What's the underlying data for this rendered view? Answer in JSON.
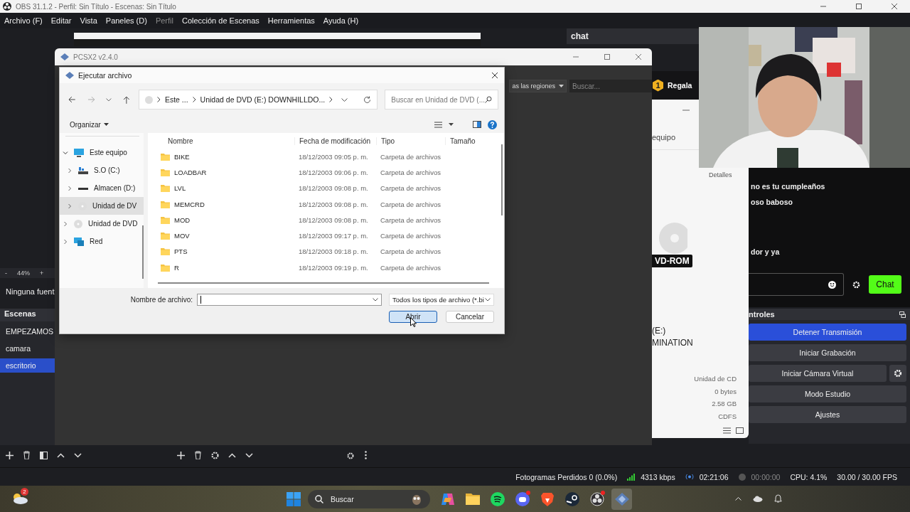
{
  "obs": {
    "title": "OBS 31.1.2 - Perfil: Sin Título - Escenas: Sin Título",
    "menu": [
      {
        "label": "Archivo (F)",
        "disabled": false
      },
      {
        "label": "Editar",
        "disabled": false
      },
      {
        "label": "Vista",
        "disabled": false
      },
      {
        "label": "Paneles (D)",
        "disabled": false
      },
      {
        "label": "Perfil",
        "disabled": true
      },
      {
        "label": "Colección de Escenas",
        "disabled": false
      },
      {
        "label": "Herramientas",
        "disabled": false
      },
      {
        "label": "Ayuda (H)",
        "disabled": false
      }
    ],
    "zoom_out": "-",
    "zoom": "44%",
    "zoom_in": "+",
    "sources_empty": "Ninguna fuent",
    "scenes": {
      "title": "Escenas",
      "items": [
        {
          "label": "EMPEZAMOS",
          "selected": false
        },
        {
          "label": "camara",
          "selected": false
        },
        {
          "label": "escritorio",
          "selected": true
        }
      ]
    },
    "chat_dock": {
      "title": "chat"
    },
    "chat": {
      "messages": [
        "no es tu cumpleaños",
        "oso baboso",
        "dor y ya"
      ],
      "send": "Chat"
    },
    "controls": {
      "title": "ntroles",
      "buttons": [
        {
          "label": "Detener Transmisión",
          "active": true,
          "settings": false
        },
        {
          "label": "Iniciar Grabación",
          "active": false,
          "settings": false
        },
        {
          "label": "Iniciar Cámara Virtual",
          "active": false,
          "settings": true
        },
        {
          "label": "Modo Estudio",
          "active": false,
          "settings": false
        },
        {
          "label": "Ajustes",
          "active": false,
          "settings": false
        }
      ]
    },
    "status_bar": {
      "dropped": "Fotogramas Perdidos 0 (0.0%)",
      "bitrate": "4313 kbps",
      "stream_time": "02:21:06",
      "record_time": "00:00:00",
      "cpu": "CPU: 4.1%",
      "fps": "30.00 / 30.00 FPS"
    }
  },
  "pcsx2": {
    "title": "PCSX2 v2.4.0",
    "region": "as las regiones",
    "search_placeholder": "Buscar..."
  },
  "properties": {
    "coin": "1",
    "gift": "Regala",
    "tab": "equipo",
    "details": "Detalles",
    "drive_label": "VD-ROM",
    "drive_lines": [
      "(E:)",
      "MINATION"
    ],
    "values": [
      "Unidad de CD",
      "0 bytes",
      "2.58 GB",
      "CDFS"
    ]
  },
  "dialog": {
    "title": "Ejecutar archivo",
    "breadcrumb": [
      "Este ...",
      "Unidad de DVD (E:) DOWNHILLDO..."
    ],
    "search_placeholder": "Buscar en Unidad de DVD (...",
    "organize": "Organizar",
    "nav": [
      {
        "label": "Este equipo",
        "kind": "pc",
        "expanded": true,
        "selected": false,
        "children": [
          {
            "label": "S.O (C:)",
            "kind": "system",
            "expanded": false,
            "selected": false
          },
          {
            "label": "Almacen (D:)",
            "kind": "drive",
            "expanded": false,
            "selected": false
          },
          {
            "label": "Unidad de DV",
            "kind": "disc",
            "expanded": false,
            "selected": true
          }
        ]
      },
      {
        "label": "Unidad de DVD",
        "kind": "disc",
        "expanded": false,
        "selected": false
      },
      {
        "label": "Red",
        "kind": "network",
        "expanded": false,
        "selected": false
      }
    ],
    "columns": [
      "Nombre",
      "Fecha de modificación",
      "Tipo",
      "Tamaño"
    ],
    "rows": [
      {
        "name": "BIKE",
        "date": "18/12/2003 09:05 p. m.",
        "type": "Carpeta de archivos"
      },
      {
        "name": "LOADBAR",
        "date": "18/12/2003 09:06 p. m.",
        "type": "Carpeta de archivos"
      },
      {
        "name": "LVL",
        "date": "18/12/2003 09:08 p. m.",
        "type": "Carpeta de archivos"
      },
      {
        "name": "MEMCRD",
        "date": "18/12/2003 09:08 p. m.",
        "type": "Carpeta de archivos"
      },
      {
        "name": "MOD",
        "date": "18/12/2003 09:08 p. m.",
        "type": "Carpeta de archivos"
      },
      {
        "name": "MOV",
        "date": "18/12/2003 09:17 p. m.",
        "type": "Carpeta de archivos"
      },
      {
        "name": "PTS",
        "date": "18/12/2003 09:18 p. m.",
        "type": "Carpeta de archivos"
      },
      {
        "name": "R",
        "date": "18/12/2003 09:19 p. m.",
        "type": "Carpeta de archivos"
      }
    ],
    "filename_label": "Nombre de archivo:",
    "filetype": "Todos los tipos de archivo (*.bi",
    "open": "Abrir",
    "cancel": "Cancelar"
  },
  "taskbar": {
    "weather_badge": "2",
    "search_placeholder": "Buscar",
    "apps": [
      {
        "kind": "start",
        "active": false,
        "badge": false
      },
      {
        "kind": "copilot",
        "active": false,
        "badge": false
      },
      {
        "kind": "folder",
        "active": false,
        "badge": false
      },
      {
        "kind": "spotify",
        "active": false,
        "badge": false
      },
      {
        "kind": "discord",
        "active": false,
        "badge": true
      },
      {
        "kind": "brave",
        "active": false,
        "badge": false
      },
      {
        "kind": "steam",
        "active": false,
        "badge": false
      },
      {
        "kind": "obs",
        "active": false,
        "badge": true
      },
      {
        "kind": "pcsx2",
        "active": true,
        "badge": false
      }
    ]
  }
}
